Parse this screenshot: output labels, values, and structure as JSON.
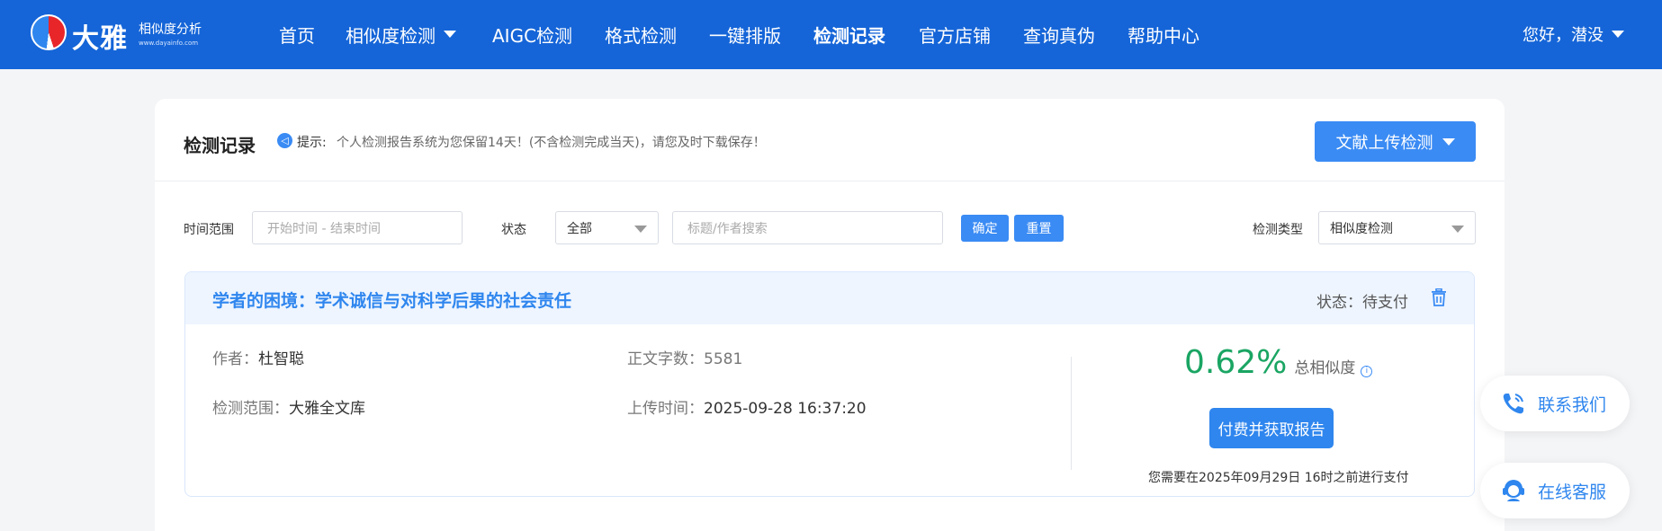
{
  "brand": {
    "name": "大雅",
    "subtitle": "相似度分析",
    "url": "www.dayainfo.com",
    "colors": {
      "primary": "#1565d8",
      "accent": "#3a8bf4",
      "success": "#1aa563"
    }
  },
  "nav": {
    "items": [
      {
        "label": "首页"
      },
      {
        "label": "相似度检测"
      },
      {
        "label": "AIGC检测"
      },
      {
        "label": "格式检测"
      },
      {
        "label": "一键排版"
      },
      {
        "label": "检测记录"
      },
      {
        "label": "官方店铺"
      },
      {
        "label": "查询真伪"
      },
      {
        "label": "帮助中心"
      }
    ],
    "user_greeting": "您好，潜没"
  },
  "page": {
    "title": "检测记录",
    "tip_label": "提示:",
    "tip_text": "个人检测报告系统为您保留14天！(不含检测完成当天)，请您及时下载保存！",
    "upload_button": "文献上传检测"
  },
  "filters": {
    "time_range_label": "时间范围",
    "time_range_placeholder": "开始时间 - 结束时间",
    "status_label": "状态",
    "status_value": "全部",
    "search_placeholder": "标题/作者搜索",
    "confirm_button": "确定",
    "reset_button": "重置",
    "type_label": "检测类型",
    "type_value": "相似度检测"
  },
  "record": {
    "title": "学者的困境：学术诚信与对科学后果的社会责任",
    "status_label": "状态：",
    "status_value": "待支付",
    "author_label": "作者：",
    "author": "杜智聪",
    "word_count_label": "正文字数：",
    "word_count": "5581",
    "scope_label": "检测范围：",
    "scope": "大雅全文库",
    "upload_time_label": "上传时间：",
    "upload_time": "2025-09-28 16:37:20",
    "similarity": "0.62%",
    "similarity_label": "总相似度",
    "pay_button": "付费并获取报告",
    "pay_note": "您需要在2025年09月29日 16时之前进行支付"
  },
  "floating": {
    "contact": "联系我们",
    "service": "在线客服"
  }
}
